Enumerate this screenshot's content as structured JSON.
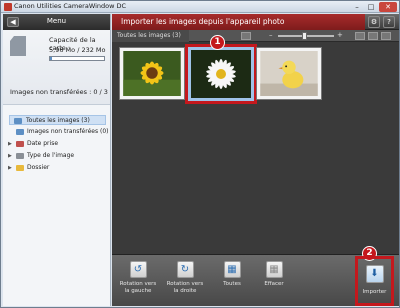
{
  "window": {
    "title": "Canon Utilities CameraWindow DC",
    "buttons": {
      "minimize": "–",
      "maximize": "□",
      "close": "✕"
    }
  },
  "sidebar": {
    "menu_label": "Menu",
    "back_glyph": "◀",
    "card": {
      "capacity_label": "Capacité de la carte :",
      "capacity_value": "5,96 Mo / 232 Mo",
      "capacity_used_fraction": 0.03,
      "not_transferred": "Images non transférées : 0 / 3"
    },
    "tree": [
      {
        "label": "Toutes les images (3)",
        "icon": "photos-icon",
        "selected": true
      },
      {
        "label": "Images non transférées (0)",
        "icon": "photos-icon",
        "selected": false
      },
      {
        "label": "Date prise",
        "icon": "calendar-icon",
        "selected": false
      },
      {
        "label": "Type de l'image",
        "icon": "image-type-icon",
        "selected": false
      },
      {
        "label": "Dossier",
        "icon": "folder-icon",
        "selected": false
      }
    ]
  },
  "main": {
    "header_title": "Importer les images depuis l'appareil photo",
    "tab_all": "Toutes les images (3)",
    "zoom_minus": "–",
    "zoom_plus": "+",
    "zoom_level": 0.45,
    "gear_glyph": "⚙",
    "help_glyph": "?",
    "thumbnails": [
      {
        "subject": "yellow-sunflower",
        "selected": false
      },
      {
        "subject": "white-daisy",
        "selected": true
      },
      {
        "subject": "yellow-chick",
        "selected": false
      }
    ],
    "callout_1": "1",
    "callout_2": "2",
    "bottom_buttons": {
      "rotate_left": "Rotation vers la gauche",
      "rotate_right": "Rotation vers la droite",
      "select_all": "Toutes",
      "clear": "Effacer",
      "import": "Importer"
    }
  },
  "colors": {
    "accent_red": "#c4181d",
    "header_red": "#a72c2c",
    "selection_blue": "#9fc3e8"
  }
}
